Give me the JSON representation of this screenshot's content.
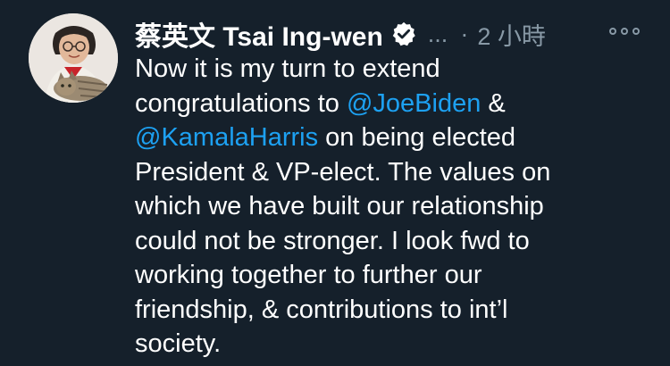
{
  "tweet": {
    "author_name": "蔡英文 Tsai Ing-wen",
    "handle": "...",
    "separator": "·",
    "timestamp": "2 小時",
    "verified_icon": "verified-badge-icon",
    "more_icon": "more-options-icon",
    "body_lines": [
      [
        "Now it is my turn to extend",
        "",
        ""
      ],
      [
        "congratulations to ",
        "@JoeBiden",
        " &"
      ],
      [
        "",
        "@KamalaHarris",
        " on being elected"
      ],
      [
        "President & VP-elect. The values on",
        "",
        ""
      ],
      [
        "which we have built our relationship",
        "",
        ""
      ],
      [
        "could not be stronger. I look fwd to",
        "",
        ""
      ],
      [
        "working together to further our",
        "",
        ""
      ],
      [
        "friendship, & contributions to int’l",
        "",
        ""
      ],
      [
        "society.",
        "",
        ""
      ]
    ]
  },
  "colors": {
    "background": "#15202b",
    "text": "#ffffff",
    "secondary_text": "#8899a6",
    "mention": "#1da1f2"
  }
}
